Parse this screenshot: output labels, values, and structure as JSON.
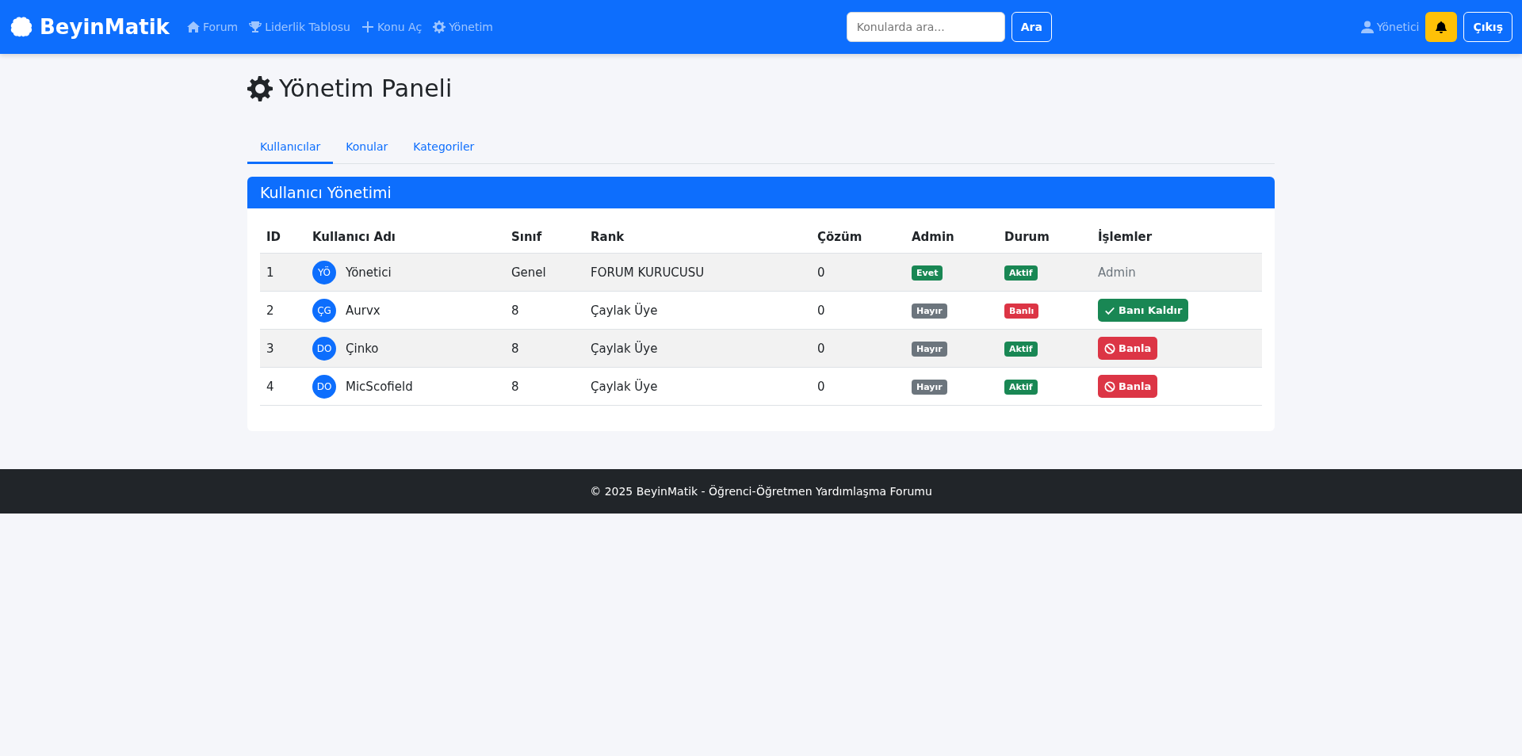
{
  "navbar": {
    "brand": "BeyinMatik",
    "links": [
      {
        "kind": "home",
        "label": "Forum"
      },
      {
        "kind": "leaderboard",
        "label": "Liderlik Tablosu"
      },
      {
        "kind": "create",
        "label": "Konu Aç"
      },
      {
        "kind": "admin",
        "label": "Yönetim"
      }
    ],
    "search": {
      "placeholder": "Konularda ara...",
      "button": "Ara"
    },
    "user": "Yönetici",
    "logout": "Çıkış"
  },
  "page": {
    "title": "Yönetim Paneli"
  },
  "tabs": [
    {
      "label": "Kullanıcılar",
      "selected": true
    },
    {
      "label": "Konular",
      "selected": false
    },
    {
      "label": "Kategoriler",
      "selected": false
    }
  ],
  "card": {
    "title": "Kullanıcı Yönetimi"
  },
  "table": {
    "columns": [
      "ID",
      "Kullanıcı Adı",
      "Sınıf",
      "Rank",
      "Çözüm",
      "Admin",
      "Durum",
      "İşlemler"
    ],
    "rows": [
      {
        "id": "1",
        "initials": "YÖ",
        "username": "Yönetici",
        "class": "Genel",
        "rank": "FORUM KURUCUSU",
        "solutions": "0",
        "admin": {
          "label": "Evet",
          "on": true
        },
        "status": {
          "label": "Aktif",
          "banned": false
        },
        "action": {
          "kind": "text",
          "label": "Admin"
        }
      },
      {
        "id": "2",
        "initials": "ÇG",
        "username": "Aurvx",
        "class": "8",
        "rank": "Çaylak Üye",
        "solutions": "0",
        "admin": {
          "label": "Hayır",
          "on": false
        },
        "status": {
          "label": "Banlı",
          "banned": true
        },
        "action": {
          "kind": "unban",
          "label": "Banı Kaldır"
        }
      },
      {
        "id": "3",
        "initials": "DO",
        "username": "Çinko",
        "class": "8",
        "rank": "Çaylak Üye",
        "solutions": "0",
        "admin": {
          "label": "Hayır",
          "on": false
        },
        "status": {
          "label": "Aktif",
          "banned": false
        },
        "action": {
          "kind": "ban",
          "label": "Banla"
        }
      },
      {
        "id": "4",
        "initials": "DO",
        "username": "MicScofield",
        "class": "8",
        "rank": "Çaylak Üye",
        "solutions": "0",
        "admin": {
          "label": "Hayır",
          "on": false
        },
        "status": {
          "label": "Aktif",
          "banned": false
        },
        "action": {
          "kind": "ban",
          "label": "Banla"
        }
      }
    ]
  },
  "footer": "© 2025 BeyinMatik - Öğrenci-Öğretmen Yardımlaşma Forumu"
}
